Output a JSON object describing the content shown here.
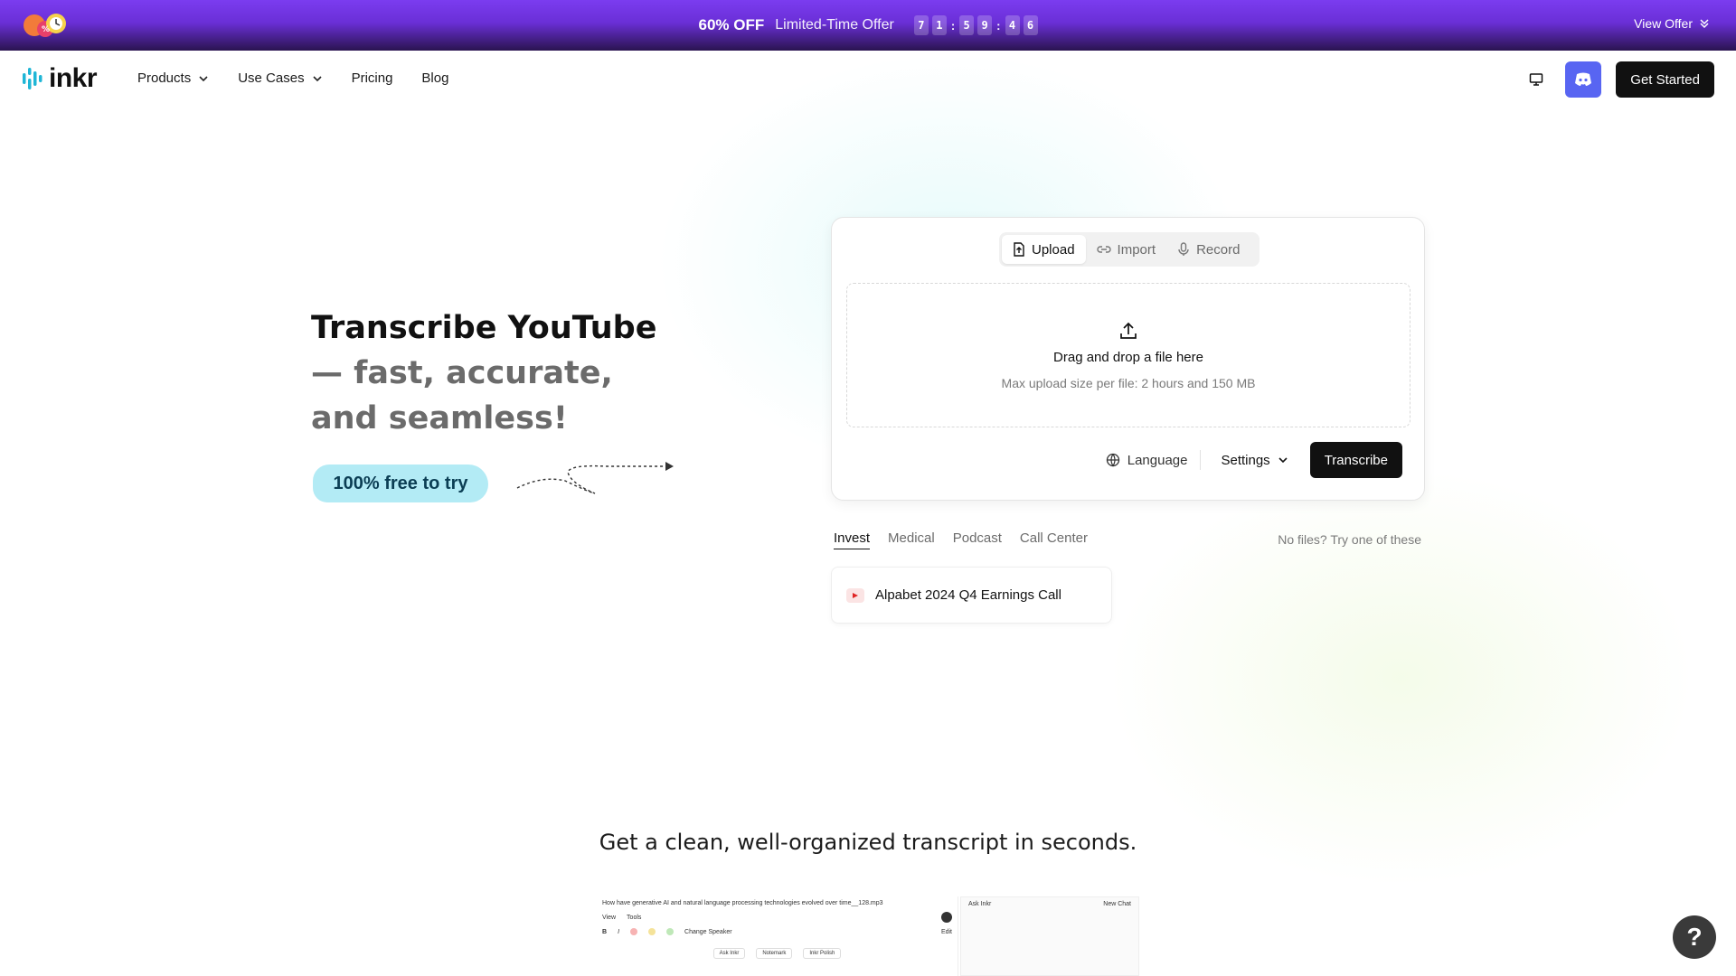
{
  "promo": {
    "discount": "60% OFF",
    "label": "Limited-Time Offer",
    "countdown": [
      "7",
      "1",
      "5",
      "9",
      "4",
      "6"
    ],
    "view_offer": "View Offer"
  },
  "nav": {
    "logo": "inkr",
    "links": [
      "Products",
      "Use Cases",
      "Pricing",
      "Blog"
    ],
    "get_started": "Get Started"
  },
  "hero": {
    "line1": "Transcribe YouTube",
    "line2": "— fast, accurate,",
    "line3": "and seamless!",
    "badge": "100% free to try"
  },
  "card": {
    "tabs": [
      "Upload",
      "Import",
      "Record"
    ],
    "active_tab": "Upload",
    "dropzone_title": "Drag and drop a file here",
    "dropzone_sub": "Max upload size per file: 2 hours and 150 MB",
    "language": "Language",
    "settings": "Settings",
    "transcribe": "Transcribe"
  },
  "examples": {
    "tabs": [
      "Invest",
      "Medical",
      "Podcast",
      "Call Center"
    ],
    "active_tab": "Invest",
    "hint": "No files? Try one of these",
    "items": [
      "Alpabet 2024 Q4 Earnings Call"
    ]
  },
  "section": {
    "subhead": "Get a clean, well-organized transcript in seconds."
  },
  "preview": {
    "file_title": "How have generative AI and natural language processing technologies evolved over time__128.mp3",
    "menu": [
      "View",
      "Tools"
    ],
    "change_speaker": "Change Speaker",
    "edit": "Edit",
    "chips": [
      "Ask Inkr",
      "Notemark",
      "Inkr Polish"
    ],
    "ask_inkr": "Ask Inkr",
    "new_chat": "New Chat"
  },
  "help": "?",
  "colors": {
    "promo_start": "#7b3cf0",
    "promo_end": "#2a1450",
    "discord": "#5865f2",
    "primary_button": "#111111",
    "free_badge": "#b3ebf5"
  }
}
